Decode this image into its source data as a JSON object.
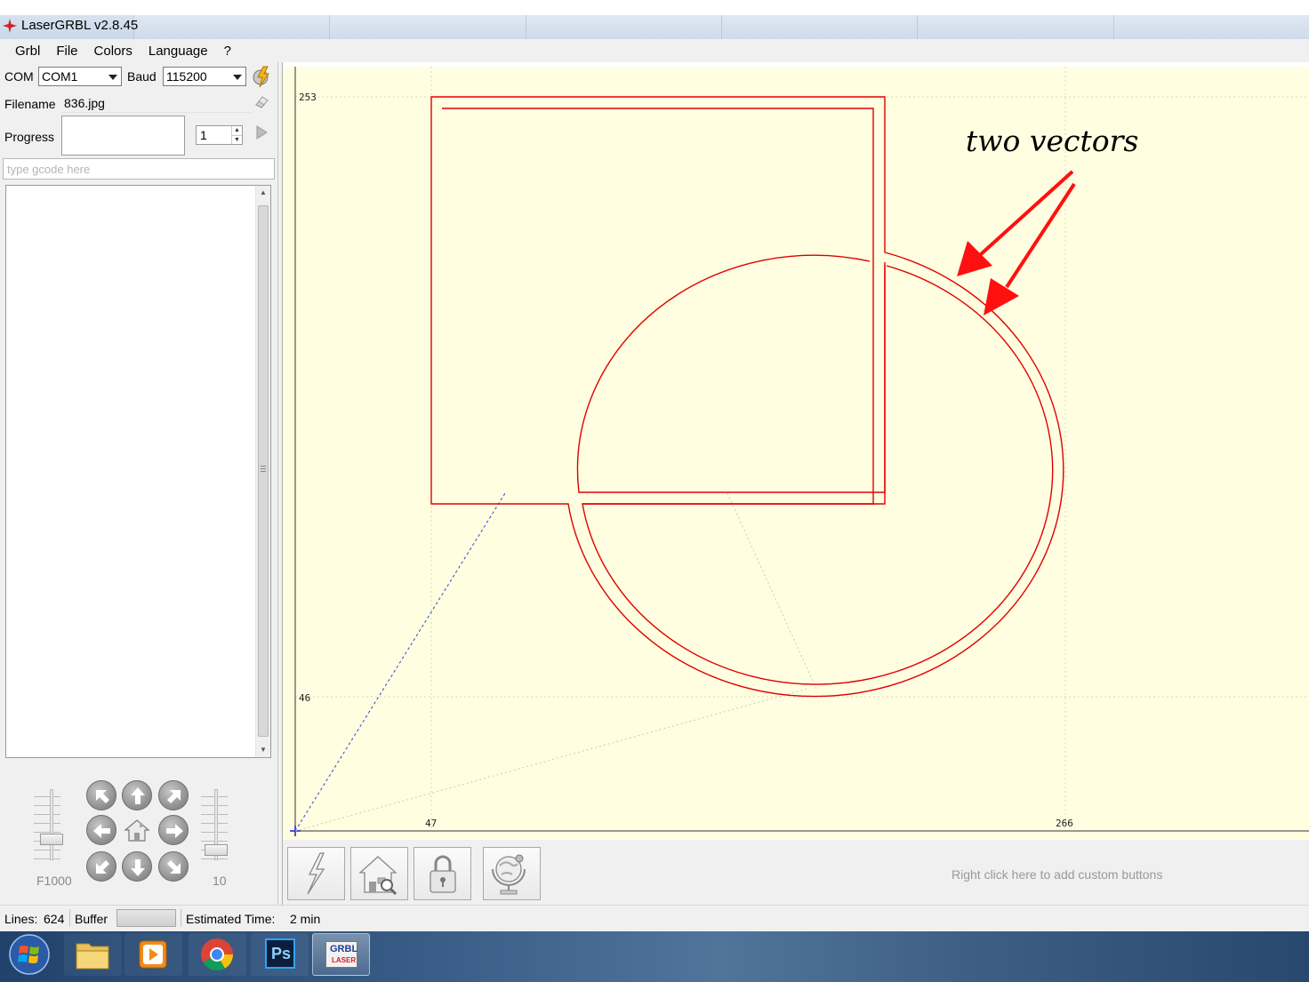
{
  "window": {
    "title": "LaserGRBL v2.8.45"
  },
  "menu": [
    "Grbl",
    "File",
    "Colors",
    "Language",
    "?"
  ],
  "connection": {
    "com_label": "COM",
    "com_value": "COM1",
    "baud_label": "Baud",
    "baud_value": "115200"
  },
  "file": {
    "filename_label": "Filename",
    "filename_value": "836.jpg",
    "progress_label": "Progress",
    "passes_value": "1"
  },
  "gcode": {
    "placeholder": "type gcode here"
  },
  "jog": {
    "speed_label": "F1000",
    "step_label": "10"
  },
  "canvas": {
    "background": "#fffee0",
    "path_color": "#e00000",
    "axis_labels": {
      "y_top": "253",
      "y_mid": "46",
      "x_left": "47",
      "x_right": "266"
    },
    "annotation": "two vectors"
  },
  "toolbar": {
    "buttons": [
      "laser-fire-icon",
      "homing-icon",
      "unlock-icon",
      "globe-icon"
    ],
    "custom_hint": "Right click here to add custom buttons"
  },
  "status": {
    "lines_label": "Lines:",
    "lines_value": "624",
    "buffer_label": "Buffer",
    "estimated_label": "Estimated Time:",
    "estimated_value": "2 min"
  },
  "taskbar": {
    "items": [
      "start-orb-icon",
      "explorer-icon",
      "media-player-icon",
      "chrome-icon",
      "photoshop-icon",
      "lasergrbl-icon"
    ],
    "ps_text": "Ps",
    "grbl_text": "GRBL",
    "laser_text": "LASER"
  }
}
